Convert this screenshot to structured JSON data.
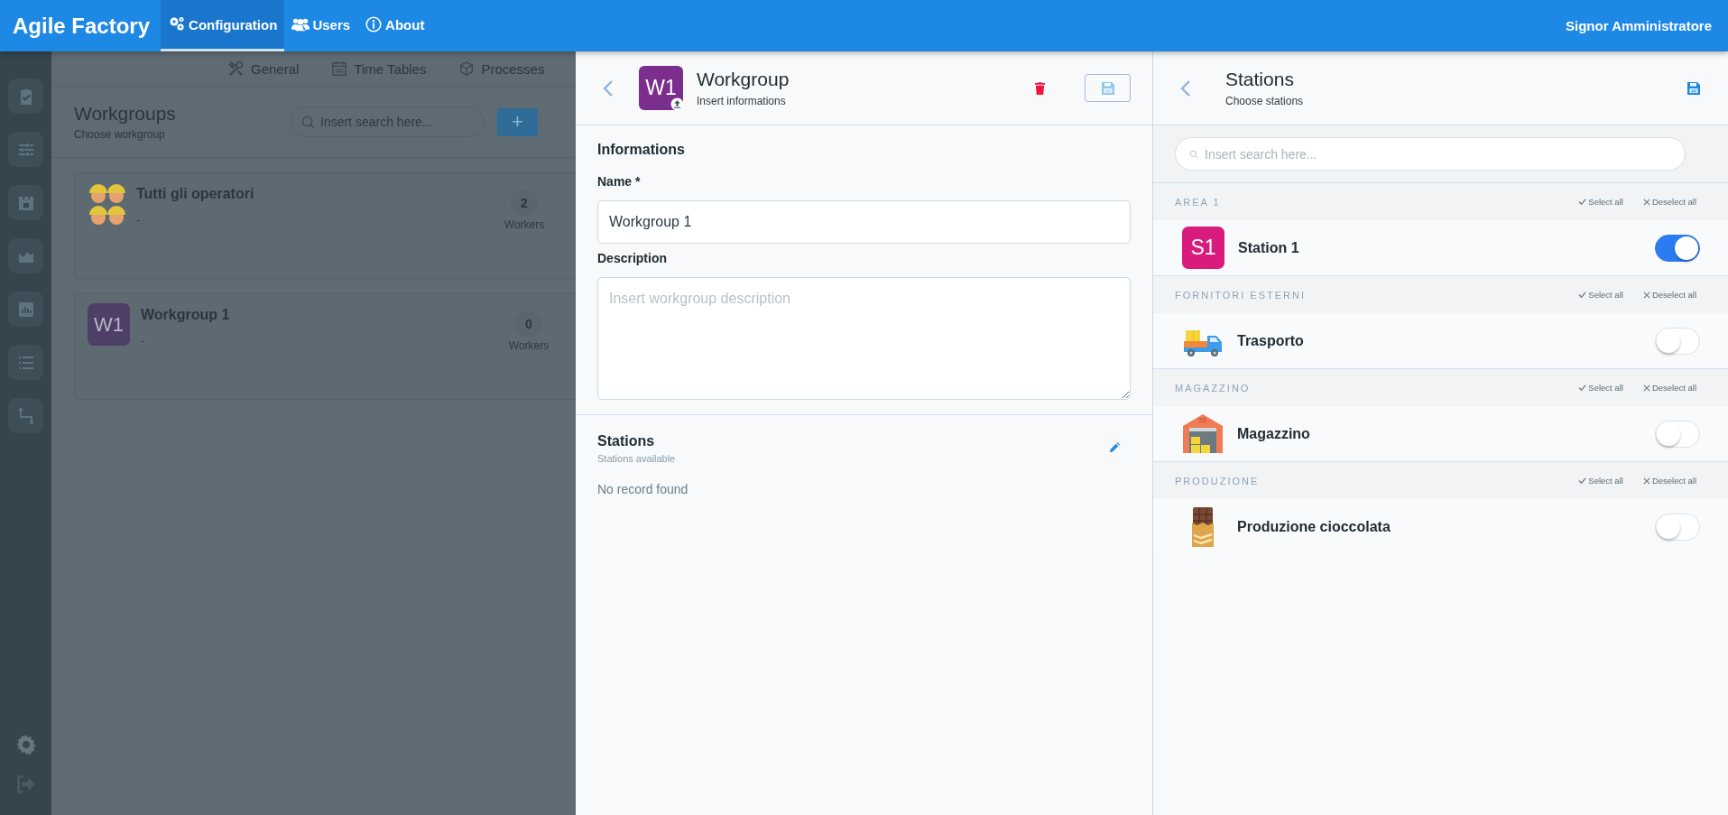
{
  "app": {
    "title": "Agile Factory"
  },
  "nav": [
    {
      "label": "Configuration",
      "selected": true
    },
    {
      "label": "Users",
      "selected": false
    },
    {
      "label": "About",
      "selected": false
    }
  ],
  "user": "Signor Amministratore",
  "config_tabs": [
    {
      "label": "General"
    },
    {
      "label": "Time Tables"
    },
    {
      "label": "Processes"
    }
  ],
  "workgroups": {
    "title": "Workgroups",
    "subtitle": "Choose workgroup",
    "search": {
      "placeholder": "Insert search here..."
    },
    "add_button": "+",
    "cards": [
      {
        "kind": "workers",
        "name": "Tutti gli operatori",
        "description": "-",
        "count": "2",
        "count_label": "Workers"
      },
      {
        "kind": "initials",
        "initials": "W1",
        "color": "#4e3f66",
        "name": "Workgroup 1",
        "description": "-",
        "count": "0",
        "count_label": "Workers"
      }
    ]
  },
  "editor": {
    "initials": "W1",
    "color": "#7b2e8e",
    "title": "Workgroup",
    "subtitle": "Insert informations",
    "section_title": "Informations",
    "name_label": "Name *",
    "name_value": "Workgroup 1",
    "description_label": "Description",
    "description_placeholder": "Insert workgroup description",
    "stations_title": "Stations",
    "stations_subtitle": "Stations available",
    "empty_text": "No record found"
  },
  "stations_panel": {
    "title": "Stations",
    "subtitle": "Choose stations",
    "search": {
      "placeholder": "Insert search here..."
    },
    "groups": [
      {
        "name": "AREA 1",
        "select_all": "Select all",
        "deselect_all": "Deselect all",
        "items": [
          {
            "kind": "initials",
            "initials": "S1",
            "color": "#d81b7d",
            "name": "Station 1",
            "on": true
          }
        ]
      },
      {
        "name": "FORNITORI ESTERNI",
        "select_all": "Select all",
        "deselect_all": "Deselect all",
        "items": [
          {
            "kind": "truck",
            "name": "Trasporto",
            "on": false
          }
        ]
      },
      {
        "name": "MAGAZZINO",
        "select_all": "Select all",
        "deselect_all": "Deselect all",
        "items": [
          {
            "kind": "warehouse",
            "name": "Magazzino",
            "on": false
          }
        ]
      },
      {
        "name": "PRODUZIONE",
        "select_all": "Select all",
        "deselect_all": "Deselect all",
        "items": [
          {
            "kind": "chocolate",
            "name": "Produzione cioccolata",
            "on": false
          }
        ]
      }
    ]
  }
}
